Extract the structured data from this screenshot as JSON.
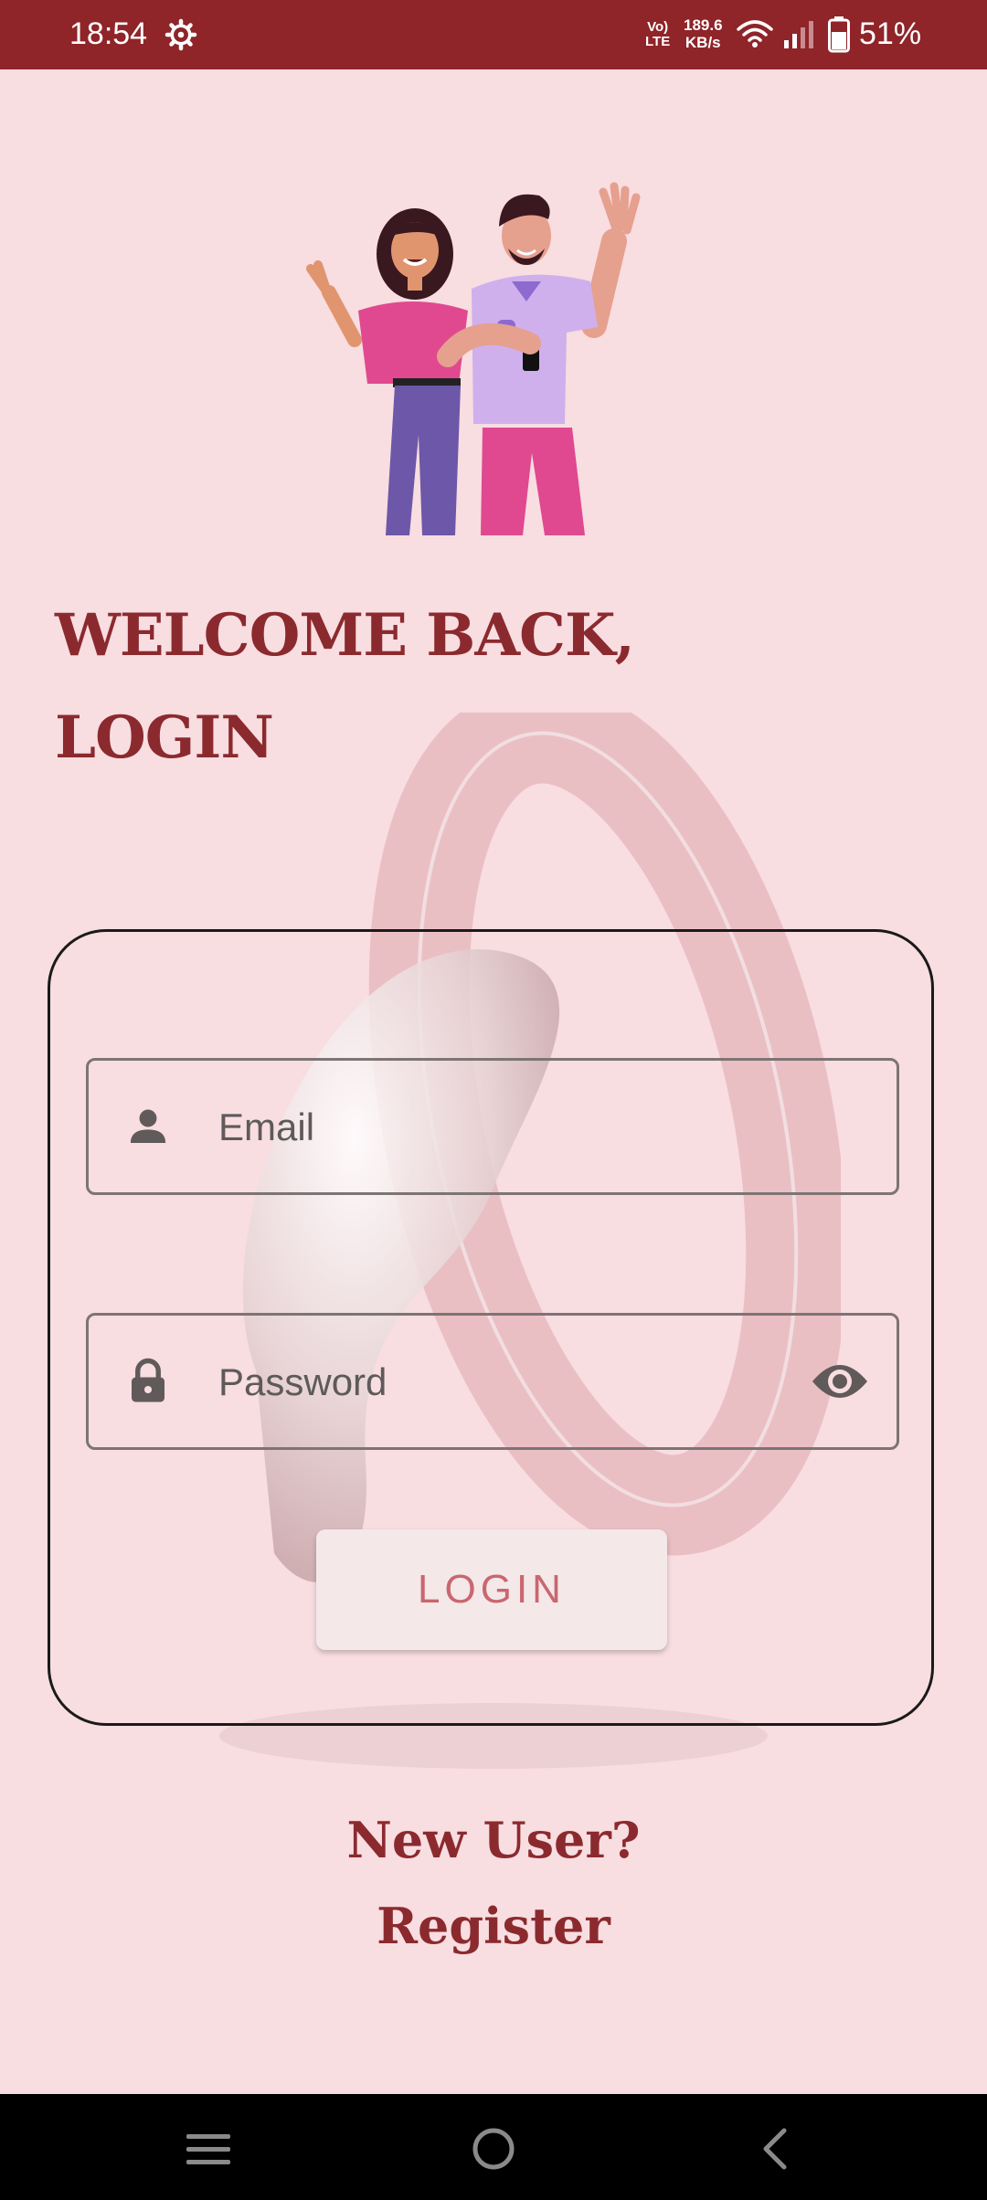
{
  "status_bar": {
    "time": "18:54",
    "network_type_top": "Vo)",
    "network_type_bottom": "LTE",
    "speed_value": "189.6",
    "speed_unit": "KB/s",
    "battery_text": "51%"
  },
  "header": {
    "title_line1": "WELCOME BACK,",
    "title_line2": "LOGIN"
  },
  "form": {
    "email_placeholder": "Email",
    "email_value": "",
    "password_placeholder": "Password",
    "password_value": "",
    "login_label": "LOGIN"
  },
  "footer": {
    "new_user_label": "New User?",
    "register_label": "Register"
  },
  "colors": {
    "brand": "#8f2429",
    "title": "#8b2a2e",
    "background": "#f8dde1",
    "button_text": "#c9676f"
  },
  "icons": [
    "gear-icon",
    "wifi-icon",
    "signal-icon",
    "battery-icon",
    "person-icon",
    "lock-icon",
    "eye-icon",
    "menu-icon",
    "home-icon",
    "back-icon"
  ]
}
